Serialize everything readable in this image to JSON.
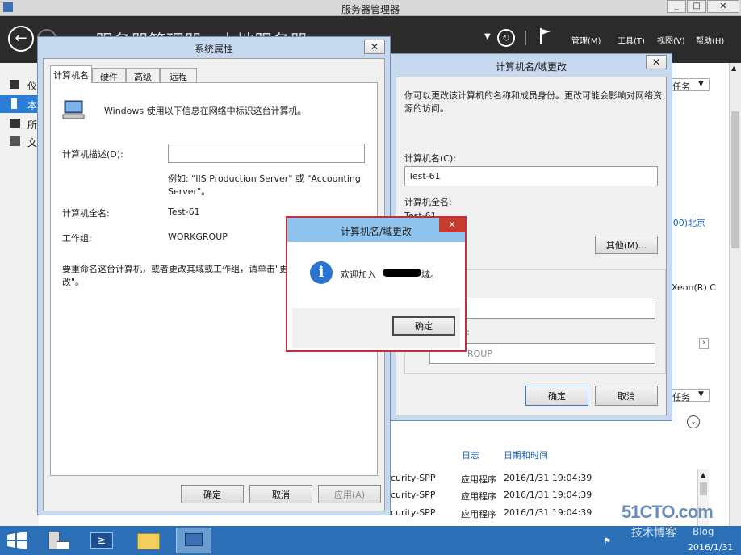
{
  "server_manager": {
    "window_title": "服务器管理器",
    "header_title": "服务器管理器 · 本地服务器",
    "menu": [
      "管理(M)",
      "工具(T)",
      "视图(V)",
      "帮助(H)"
    ],
    "sidebar": [
      "仪",
      "本",
      "所",
      "文"
    ],
    "tasks_1": "任务",
    "tasks_2": "任务",
    "timezone_fragment": ":00)北京",
    "cpu_fragment": "Xeon(R) C",
    "events": {
      "col_log": "日志",
      "col_datetime": "日期和时间",
      "rows": [
        {
          "source": "curity-SPP",
          "log": "应用程序",
          "datetime": "2016/1/31 19:04:39"
        },
        {
          "source": "curity-SPP",
          "log": "应用程序",
          "datetime": "2016/1/31 19:04:39"
        },
        {
          "source": "curity-SPP",
          "log": "应用程序",
          "datetime": "2016/1/31 19:04:39"
        }
      ]
    }
  },
  "sys_props": {
    "title": "系统属性",
    "tabs": [
      "计算机名",
      "硬件",
      "高级",
      "远程"
    ],
    "info_text": "Windows 使用以下信息在网络中标识这台计算机。",
    "desc_label": "计算机描述(D):",
    "desc_value": "",
    "example_text_1": "例如: \"IIS Production Server\" 或 \"Accounting",
    "example_text_2": "Server\"。",
    "fullname_label": "计算机全名:",
    "fullname_value": "Test-61",
    "workgroup_label": "工作组:",
    "workgroup_value": "WORKGROUP",
    "rename_text_1": "要重命名这台计算机，或者更改其域或工作组，请单击\"更",
    "rename_text_2": "改\"。",
    "ok": "确定",
    "cancel": "取消",
    "apply": "应用(A)"
  },
  "domain_change": {
    "title": "计算机名/域更改",
    "intro_1": "你可以更改该计算机的名称和成员身份。更改可能会影响对网络资",
    "intro_2": "源的访问。",
    "name_label": "计算机名(C):",
    "name_value": "Test-61",
    "fullname_label": "计算机全名:",
    "fullname_value": "Test-61",
    "more_button": "其他(M)...",
    "domain_field_fragment": "",
    "workgroup_label_fragment": "):",
    "workgroup_fragment": "ROUP",
    "ok": "确定",
    "cancel": "取消"
  },
  "welcome_dialog": {
    "title": "计算机名/域更改",
    "message_prefix": "欢迎加入",
    "message_suffix": "域。",
    "ok": "确定"
  },
  "taskbar": {
    "clock_date": "2016/1/31"
  },
  "watermark": {
    "line1": "51CTO.com",
    "line2": "技术博客",
    "line3": "Blog"
  }
}
